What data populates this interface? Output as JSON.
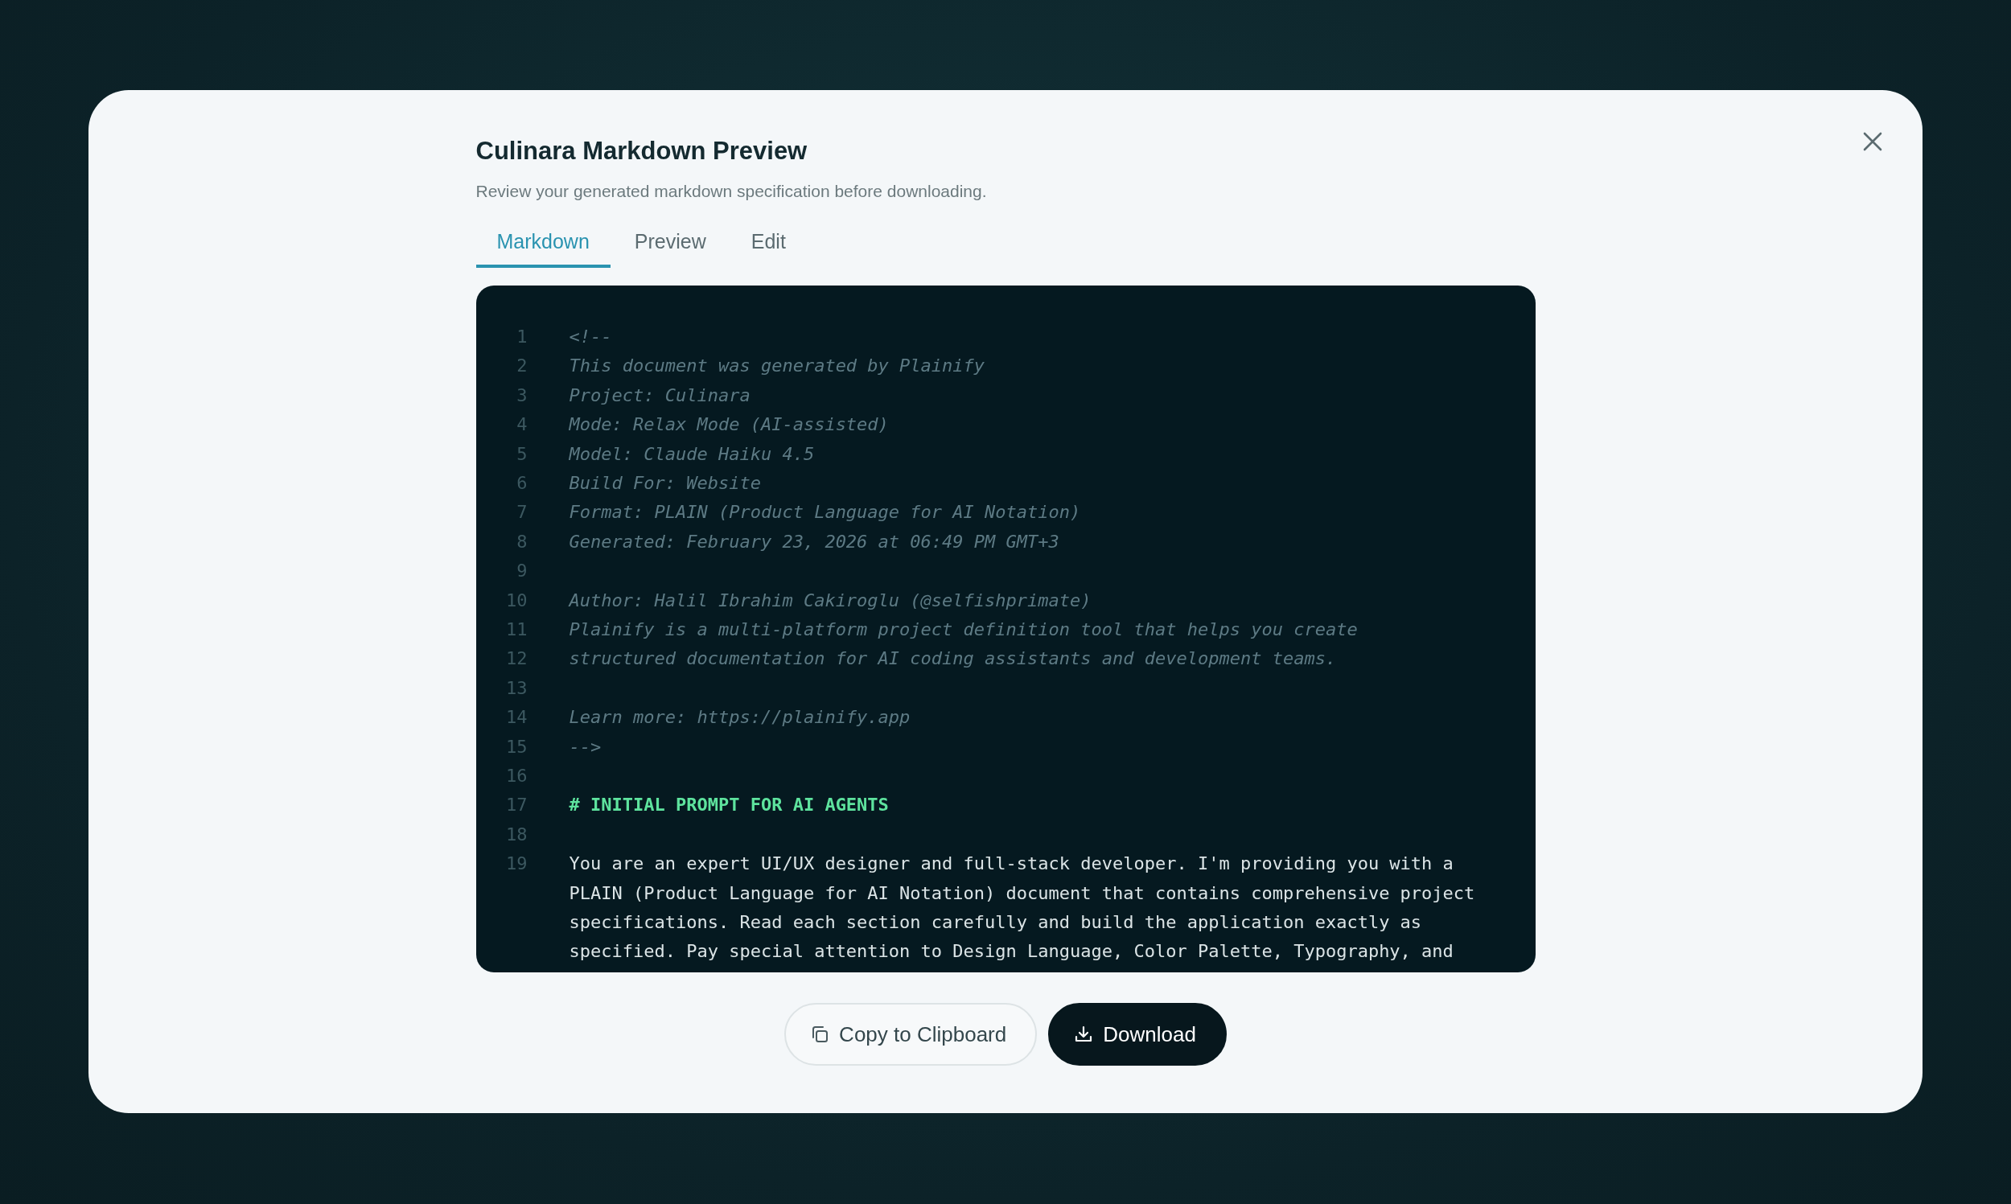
{
  "dialog": {
    "title": "Culinara Markdown Preview",
    "description": "Review your generated markdown specification before downloading."
  },
  "tabs": [
    {
      "label": "Markdown",
      "selected": true
    },
    {
      "label": "Preview",
      "selected": false
    },
    {
      "label": "Edit",
      "selected": false
    }
  ],
  "code_lines": [
    {
      "number": "1",
      "kind": "comment",
      "text": "<!--"
    },
    {
      "number": "2",
      "kind": "comment",
      "text": "This document was generated by Plainify"
    },
    {
      "number": "3",
      "kind": "comment",
      "text": "Project: Culinara"
    },
    {
      "number": "4",
      "kind": "comment",
      "text": "Mode: Relax Mode (AI-assisted)"
    },
    {
      "number": "5",
      "kind": "comment",
      "text": "Model: Claude Haiku 4.5"
    },
    {
      "number": "6",
      "kind": "comment",
      "text": "Build For: Website"
    },
    {
      "number": "7",
      "kind": "comment",
      "text": "Format: PLAIN (Product Language for AI Notation)"
    },
    {
      "number": "8",
      "kind": "comment",
      "text": "Generated: February 23, 2026 at 06:49 PM GMT+3"
    },
    {
      "number": "9",
      "kind": "blank"
    },
    {
      "number": "10",
      "kind": "comment",
      "text": "Author: Halil Ibrahim Cakiroglu (@selfishprimate)"
    },
    {
      "number": "11",
      "kind": "comment",
      "text": "Plainify is a multi-platform project definition tool that helps you create"
    },
    {
      "number": "12",
      "kind": "comment",
      "text": "structured documentation for AI coding assistants and development teams."
    },
    {
      "number": "13",
      "kind": "blank"
    },
    {
      "number": "14",
      "kind": "comment",
      "text": "Learn more: https://plainify.app"
    },
    {
      "number": "15",
      "kind": "comment",
      "text": "-->"
    },
    {
      "number": "16",
      "kind": "blank"
    },
    {
      "number": "17",
      "kind": "heading",
      "text": "# INITIAL PROMPT FOR AI AGENTS"
    },
    {
      "number": "18",
      "kind": "blank"
    },
    {
      "number": "19",
      "kind": "text",
      "text": "You are an expert UI/UX designer and full-stack developer. I'm providing you with a PLAIN (Product Language for AI Notation) document that contains comprehensive project specifications. Read each section carefully and build the application exactly as specified. Pay special attention to Design Language, Color Palette, Typography, and"
    }
  ],
  "buttons": [
    {
      "label": "Copy to Clipboard",
      "kind": "copy"
    },
    {
      "label": "Download",
      "kind": "download"
    }
  ]
}
